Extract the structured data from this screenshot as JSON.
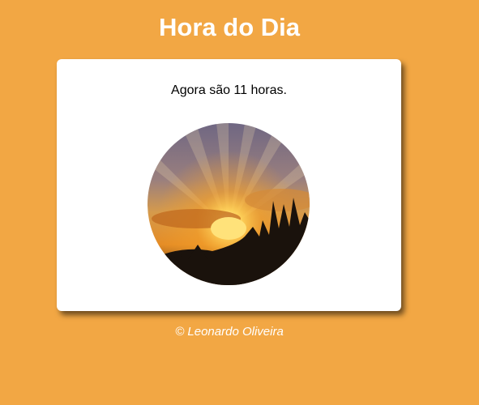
{
  "header": {
    "title": "Hora do Dia"
  },
  "card": {
    "message": "Agora são 11 horas.",
    "image": {
      "icon": "sunset-photo",
      "description_colors": {
        "sky_top": "#7a6e86",
        "sun": "#ffe27a",
        "glow": "#f3a52a",
        "silhouette": "#1a120c"
      }
    }
  },
  "footer": {
    "credit": "© Leonardo Oliveira"
  },
  "colors": {
    "background": "#f2a744",
    "card": "#ffffff",
    "title": "#ffffff"
  }
}
